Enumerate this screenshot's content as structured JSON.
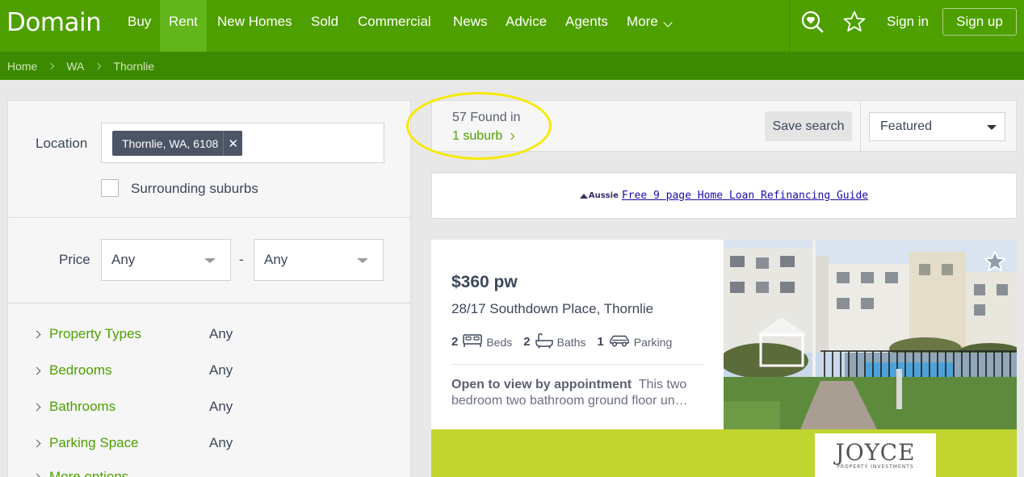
{
  "brand": {
    "logo": "Domain",
    "green": "#4ea000",
    "dark_green": "#3c8a00"
  },
  "nav": {
    "items": [
      "Buy",
      "Rent",
      "New Homes",
      "Sold",
      "Commercial",
      "News",
      "Advice",
      "Agents",
      "More"
    ],
    "active": "Rent",
    "sign_in": "Sign in",
    "sign_up": "Sign up"
  },
  "breadcrumb": [
    "Home",
    "WA",
    "Thornlie"
  ],
  "filters": {
    "location_label": "Location",
    "location_chip": "Thornlie, WA, 6108",
    "surrounding_label": "Surrounding suburbs",
    "surrounding_checked": false,
    "price_label": "Price",
    "price_min": "Any",
    "price_max": "Any",
    "price_sep": "-",
    "rows": [
      {
        "label": "Property Types",
        "value": "Any"
      },
      {
        "label": "Bedrooms",
        "value": "Any"
      },
      {
        "label": "Bathrooms",
        "value": "Any"
      },
      {
        "label": "Parking Space",
        "value": "Any"
      },
      {
        "label": "More options",
        "value": ""
      }
    ]
  },
  "results": {
    "found_text": "57 Found in",
    "suburb_link": "1 suburb",
    "save_search": "Save search",
    "sort": "Featured"
  },
  "ad": {
    "brand": "Aussie",
    "link_text": "Free 9 page Home Loan Refinancing Guide"
  },
  "listing": {
    "price": "$360 pw",
    "address": "28/17 Southdown Place, Thornlie",
    "beds": "2",
    "beds_label": "Beds",
    "baths": "2",
    "baths_label": "Baths",
    "parking": "1",
    "parking_label": "Parking",
    "desc_bold": "Open to view by appointment",
    "desc_text": "This two bedroom two bathroom ground floor un…",
    "agency_name": "JOYCE",
    "agency_sub": "PROPERTY INVESTMENTS"
  }
}
